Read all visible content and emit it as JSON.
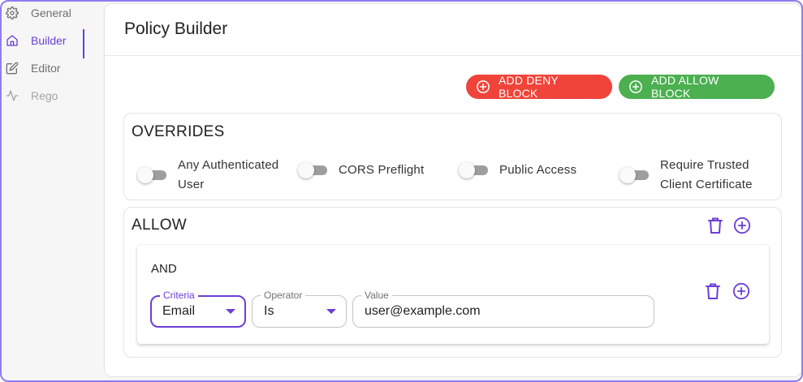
{
  "sidebar": {
    "items": [
      {
        "label": "General",
        "icon": "gear-icon"
      },
      {
        "label": "Builder",
        "icon": "home-icon",
        "active": true
      },
      {
        "label": "Editor",
        "icon": "edit-icon"
      },
      {
        "label": "Rego",
        "icon": "activity-icon"
      }
    ]
  },
  "page": {
    "title": "Policy Builder"
  },
  "toolbar": {
    "deny_label": "ADD DENY BLOCK",
    "allow_label": "ADD ALLOW BLOCK"
  },
  "overrides": {
    "title": "OVERRIDES",
    "toggles": [
      {
        "label_lines": [
          "Any Authenticated",
          "User"
        ],
        "on": false
      },
      {
        "label_lines": [
          "CORS Preflight"
        ],
        "on": false
      },
      {
        "label_lines": [
          "Public Access"
        ],
        "on": false
      },
      {
        "label_lines": [
          "Require Trusted",
          "Client Certificate"
        ],
        "on": false
      }
    ]
  },
  "allow_block": {
    "title": "ALLOW",
    "and_group": {
      "title": "AND",
      "criteria": {
        "label": "Criteria",
        "value": "Email"
      },
      "operator": {
        "label": "Operator",
        "value": "Is"
      },
      "value": {
        "label": "Value",
        "value": "user@example.com"
      }
    }
  },
  "colors": {
    "accent": "#6b3fd6",
    "deny": "#f0443a",
    "allow": "#4caf50",
    "frame": "#8f7df0"
  }
}
